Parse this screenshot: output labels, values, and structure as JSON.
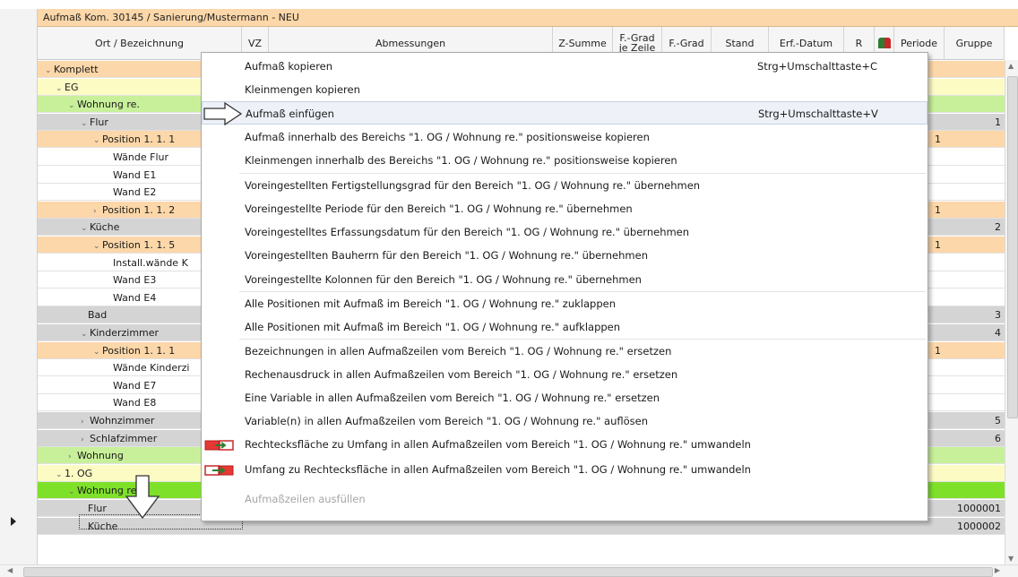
{
  "window": {
    "title": "Aufmaß Kom. 30145 / Sanierung/Mustermann - NEU"
  },
  "columns": {
    "ort": "Ort / Bezeichnung",
    "vz": "VZ",
    "abm": "Abmessungen",
    "zsum": "Z-Summe",
    "fgz1": "F.-Grad",
    "fgz2": "je Zeile",
    "fgrad": "F.-Grad",
    "stand": "Stand",
    "erf": "Erf.-Datum",
    "r": "R",
    "periode": "Periode",
    "gruppe": "Gruppe"
  },
  "tree": [
    {
      "label": "Komplett",
      "exp": "⌄",
      "gruppe": ""
    },
    {
      "label": "EG",
      "exp": "⌄",
      "gruppe": ""
    },
    {
      "label": "Wohnung re.",
      "exp": "⌄",
      "gruppe": ""
    },
    {
      "label": "Flur",
      "exp": "⌄",
      "gruppe": "1"
    },
    {
      "label": "Position 1. 1. 1",
      "exp": "⌄",
      "gruppe": "",
      "periode": "1"
    },
    {
      "label": "Wände Flur",
      "exp": "",
      "gruppe": ""
    },
    {
      "label": "Wand E1",
      "exp": "",
      "gruppe": ""
    },
    {
      "label": "Wand E2",
      "exp": "",
      "gruppe": ""
    },
    {
      "label": "Position 1. 1. 2",
      "exp": "›",
      "gruppe": "",
      "periode": "1"
    },
    {
      "label": "Küche",
      "exp": "⌄",
      "gruppe": "2"
    },
    {
      "label": "Position 1. 1. 5",
      "exp": "⌄",
      "gruppe": "",
      "periode": "1"
    },
    {
      "label": "Install.wände K",
      "exp": "",
      "gruppe": ""
    },
    {
      "label": "Wand E3",
      "exp": "",
      "gruppe": ""
    },
    {
      "label": "Wand E4",
      "exp": "",
      "gruppe": ""
    },
    {
      "label": "Bad",
      "exp": "",
      "gruppe": "3"
    },
    {
      "label": "Kinderzimmer",
      "exp": "⌄",
      "gruppe": "4"
    },
    {
      "label": "Position 1. 1. 1",
      "exp": "⌄",
      "gruppe": "",
      "periode": "1"
    },
    {
      "label": "Wände Kinderzi",
      "exp": "",
      "gruppe": ""
    },
    {
      "label": "Wand E7",
      "exp": "",
      "gruppe": ""
    },
    {
      "label": "Wand E8",
      "exp": "",
      "gruppe": ""
    },
    {
      "label": "Wohnzimmer",
      "exp": "›",
      "gruppe": "5"
    },
    {
      "label": "Schlafzimmer",
      "exp": "›",
      "gruppe": "6"
    },
    {
      "label": "Wohnung",
      "exp": "›",
      "gruppe": ""
    },
    {
      "label": "1. OG",
      "exp": "⌄",
      "gruppe": ""
    },
    {
      "label": "Wohnung re.",
      "exp": "⌄",
      "gruppe": ""
    },
    {
      "label": "Flur",
      "exp": "",
      "gruppe": "1000001"
    },
    {
      "label": "Küche",
      "exp": "",
      "gruppe": "1000002"
    }
  ],
  "menu": [
    {
      "label": "Aufmaß kopieren",
      "shortcut": "Strg+Umschalttaste+C"
    },
    {
      "label": "Kleinmengen kopieren",
      "shortcut": ""
    },
    {
      "label": "Aufmaß einfügen",
      "shortcut": "Strg+Umschalttaste+V"
    },
    {
      "label": "Aufmaß innerhalb des Bereichs \"1. OG / Wohnung re.\" positionsweise kopieren",
      "shortcut": ""
    },
    {
      "label": "Kleinmengen innerhalb des Bereichs \"1. OG / Wohnung re.\" positionsweise kopieren",
      "shortcut": ""
    },
    {
      "label": "Voreingestellten Fertigstellungsgrad für den Bereich \"1. OG / Wohnung re.\" übernehmen",
      "shortcut": ""
    },
    {
      "label": "Voreingestellte Periode für den Bereich \"1. OG / Wohnung re.\" übernehmen",
      "shortcut": ""
    },
    {
      "label": "Voreingestelltes Erfassungsdatum für den Bereich \"1. OG / Wohnung re.\" übernehmen",
      "shortcut": ""
    },
    {
      "label": "Voreingestellten Bauherrn für den Bereich \"1. OG / Wohnung re.\" übernehmen",
      "shortcut": ""
    },
    {
      "label": "Voreingestellte Kolonnen für den Bereich \"1. OG / Wohnung re.\" übernehmen",
      "shortcut": ""
    },
    {
      "label": "Alle Positionen mit Aufmaß im Bereich \"1. OG / Wohnung re.\" zuklappen",
      "shortcut": ""
    },
    {
      "label": "Alle Positionen mit Aufmaß im Bereich \"1. OG / Wohnung re.\" aufklappen",
      "shortcut": ""
    },
    {
      "label": "Bezeichnungen in allen Aufmaßzeilen vom Bereich \"1. OG / Wohnung re.\" ersetzen",
      "shortcut": ""
    },
    {
      "label": "Rechenausdruck in allen Aufmaßzeilen vom Bereich \"1. OG / Wohnung re.\" ersetzen",
      "shortcut": ""
    },
    {
      "label": "Eine Variable in allen Aufmaßzeilen vom Bereich \"1. OG / Wohnung re.\" ersetzen",
      "shortcut": ""
    },
    {
      "label": "Variable(n) in allen Aufmaßzeilen vom Bereich \"1. OG / Wohnung re.\" auflösen",
      "shortcut": ""
    },
    {
      "label": "Rechtecksfläche zu Umfang in allen Aufmaßzeilen vom Bereich \"1. OG / Wohnung re.\" umwandeln",
      "shortcut": ""
    },
    {
      "label": "Umfang zu Rechtecksfläche in allen Aufmaßzeilen vom Bereich \"1. OG / Wohnung re.\" umwandeln",
      "shortcut": ""
    },
    {
      "label": "Aufmaßzeilen ausfüllen",
      "shortcut": ""
    }
  ],
  "colors": {
    "orange": "#fcd7a9",
    "yellow": "#fdfbc4",
    "lightgreen": "#c8f09a",
    "grey": "#d4d4d4",
    "brightgreen": "#7fe02a"
  }
}
